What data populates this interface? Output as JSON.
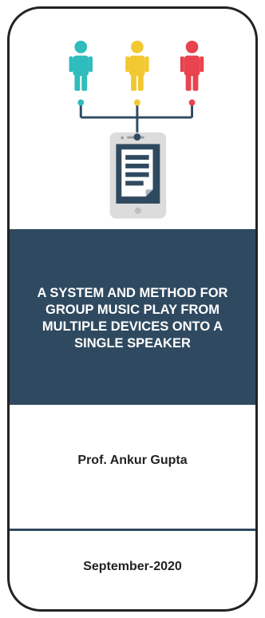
{
  "cover": {
    "title": "A SYSTEM AND METHOD FOR GROUP MUSIC PLAY FROM MULTIPLE DEVICES ONTO A SINGLE SPEAKER",
    "author": "Prof. Ankur Gupta",
    "date": "September-2020"
  },
  "colors": {
    "band": "#2f4a60",
    "person_left": "#2fbcbc",
    "person_middle": "#f2c830",
    "person_right": "#e8434f",
    "connector": "#2f4a60",
    "phone_body": "#dcdcdc",
    "document": "#2f4a60"
  },
  "icons": [
    "person-icon",
    "person-icon",
    "person-icon",
    "smartphone-icon",
    "document-icon"
  ]
}
